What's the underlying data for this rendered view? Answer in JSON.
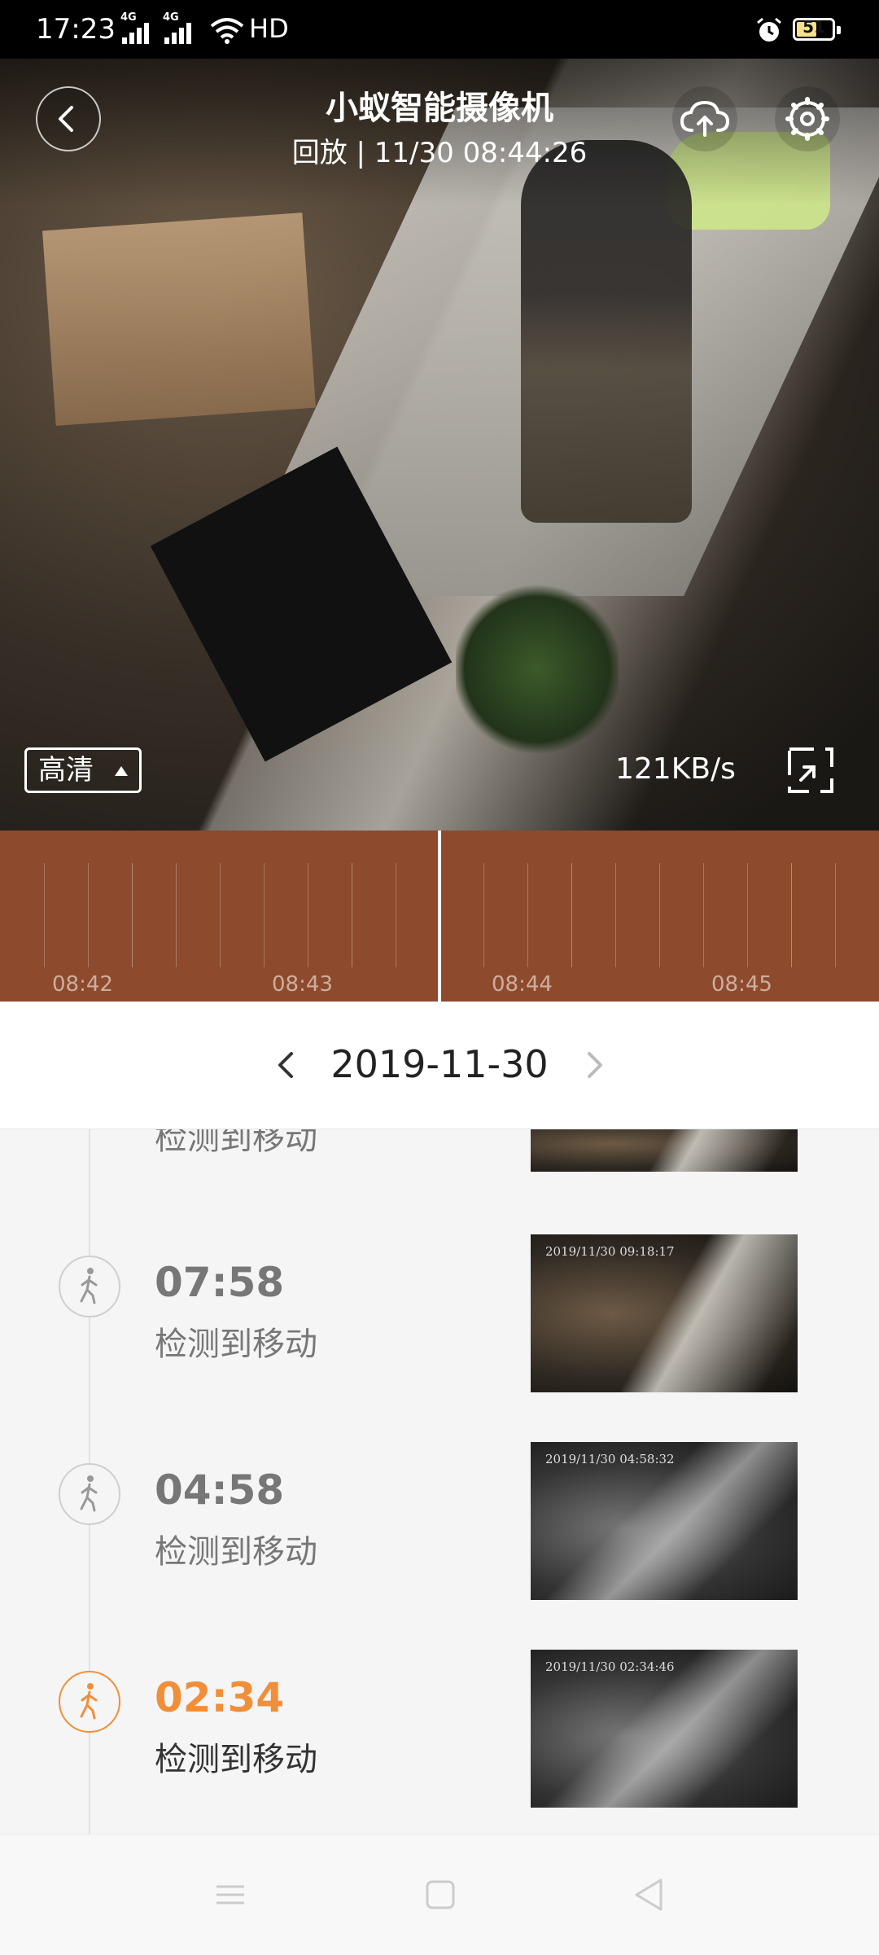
{
  "status_bar": {
    "time": "17:23",
    "network_1": "4G",
    "network_2": "4G",
    "hd_label": "HD",
    "battery": "51"
  },
  "player": {
    "camera_name": "小蚁智能摄像机",
    "playback_info": "回放 | 11/30 08:44:26",
    "quality_label": "高清",
    "speed": "121KB/s"
  },
  "timeline": {
    "labels": [
      "08:42",
      "08:43",
      "08:44",
      "08:45"
    ],
    "color": "#8e4a2c"
  },
  "date_nav": {
    "date": "2019-11-30"
  },
  "events": {
    "partial": {
      "label": "检测到移动"
    },
    "items": [
      {
        "time": "07:58",
        "label": "检测到移动",
        "thumb_stamp": "2019/11/30  09:18:17",
        "active": false
      },
      {
        "time": "04:58",
        "label": "检测到移动",
        "thumb_stamp": "2019/11/30  04:58:32",
        "active": false
      },
      {
        "time": "02:34",
        "label": "检测到移动",
        "thumb_stamp": "2019/11/30  02:34:46",
        "active": true
      }
    ]
  },
  "colors": {
    "accent": "#f08f3a",
    "timeline_bg": "#8e4a2c"
  },
  "icons": {
    "back": "chevron-left-icon",
    "cloud": "cloud-upload-icon",
    "settings": "gear-icon",
    "fullscreen": "fullscreen-icon",
    "motion": "walking-person-icon"
  }
}
